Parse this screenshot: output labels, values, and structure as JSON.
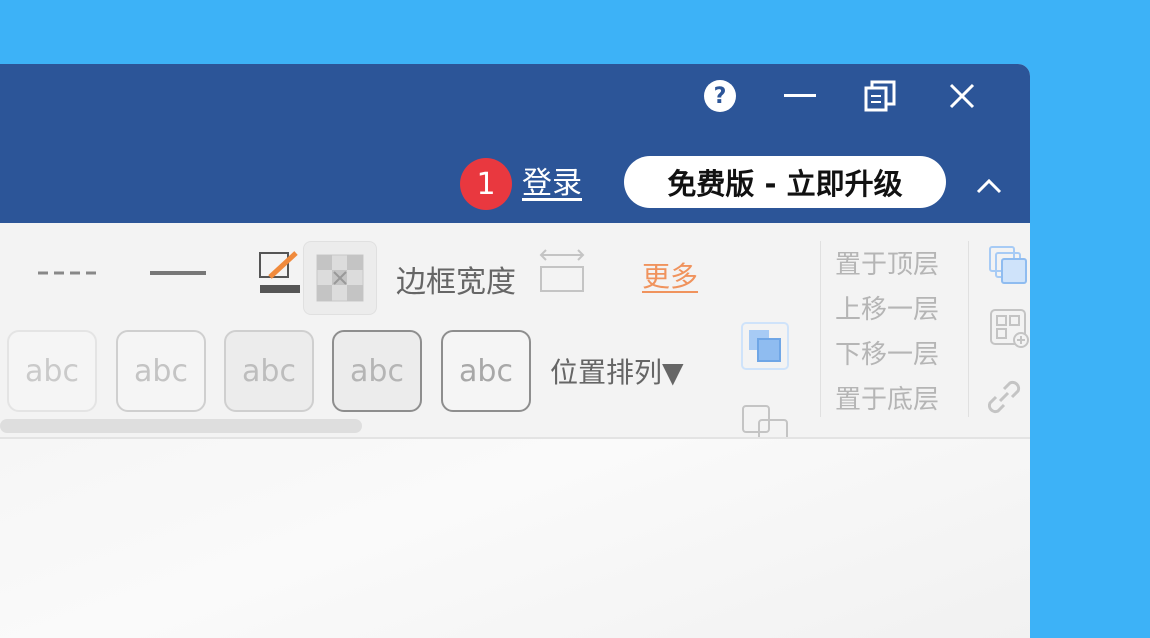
{
  "titlebar": {
    "help_symbol": "?",
    "icons": [
      "help-icon",
      "minimize-icon",
      "restore-icon",
      "close-icon",
      "chevron-up-icon"
    ],
    "step_badge": "1",
    "login_label": "登录",
    "upgrade_label": "免费版 - 立即升级"
  },
  "ribbon": {
    "border_width_label": "边框宽度",
    "more_label": "更多",
    "style_samples": [
      "abc",
      "abc",
      "abc",
      "abc",
      "abc"
    ],
    "arrange_label": "位置排列▼",
    "layer_menu": [
      "置于顶层",
      "上移一层",
      "下移一层",
      "置于底层"
    ]
  },
  "colors": {
    "desktop": "#3db2f7",
    "titlebar": "#2c5598",
    "badge": "#e9383f",
    "more_link": "#f0935d",
    "ribbon_bg": "#f3f3f3"
  }
}
